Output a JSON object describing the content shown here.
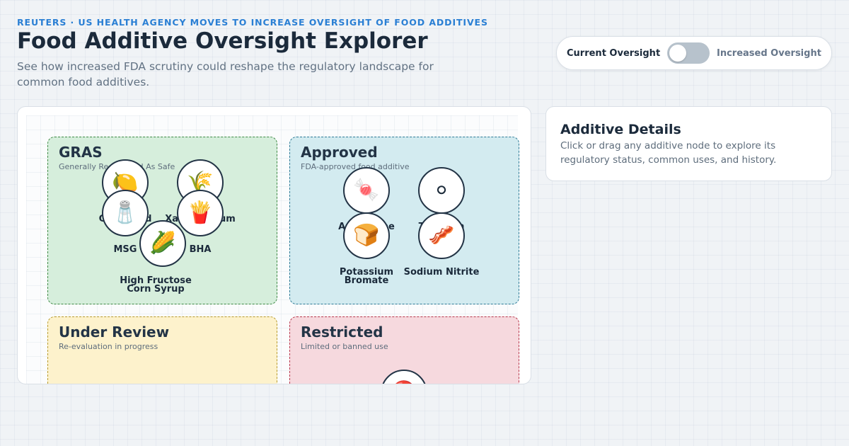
{
  "header": {
    "kicker": "REUTERS · US HEALTH AGENCY MOVES TO INCREASE OVERSIGHT OF FOOD ADDITIVES",
    "title": "Food Additive Oversight Explorer",
    "subtitle": "See how increased FDA scrutiny could reshape the regulatory landscape for common food additives."
  },
  "toggle": {
    "left_label": "Current Oversight",
    "right_label": "Increased Oversight",
    "state": "off"
  },
  "zones": {
    "gras": {
      "title": "GRAS",
      "subtitle": "Generally Recognized As Safe"
    },
    "approved": {
      "title": "Approved",
      "subtitle": "FDA-approved food additive"
    },
    "review": {
      "title": "Under Review",
      "subtitle": "Re-evaluation in progress"
    },
    "restricted": {
      "title": "Restricted",
      "subtitle": "Limited or banned use"
    }
  },
  "nodes": {
    "citric_acid": {
      "label": "Citric Acid",
      "icon": "lemon-icon",
      "glyph": "🍋"
    },
    "xanthan_gum": {
      "label": "Xanthan Gum",
      "icon": "wheat-icon",
      "glyph": "🌾"
    },
    "msg": {
      "label": "MSG",
      "icon": "salt-shaker-icon",
      "glyph": "🧂"
    },
    "bha": {
      "label": "BHA",
      "icon": "fries-icon",
      "glyph": "🍟"
    },
    "hfcs": {
      "label": "High Fructose Corn Syrup",
      "icon": "corn-icon",
      "glyph": "🌽"
    },
    "aspartame": {
      "label": "Aspartame",
      "icon": "candy-icon",
      "glyph": "🍬"
    },
    "titanium": {
      "label": "Titanium",
      "icon": "ring-icon",
      "glyph": "⭘"
    },
    "potassium_bromate": {
      "label": "Potassium Bromate",
      "icon": "bread-icon",
      "glyph": "🍞"
    },
    "sodium_nitrite": {
      "label": "Sodium Nitrite",
      "icon": "bacon-icon",
      "glyph": "🥓"
    },
    "red_dye": {
      "label": "",
      "icon": "red-circle-icon",
      "glyph": "🔴"
    }
  },
  "details": {
    "title": "Additive Details",
    "body": "Click or drag any additive node to explore its regulatory status, common uses, and history."
  }
}
